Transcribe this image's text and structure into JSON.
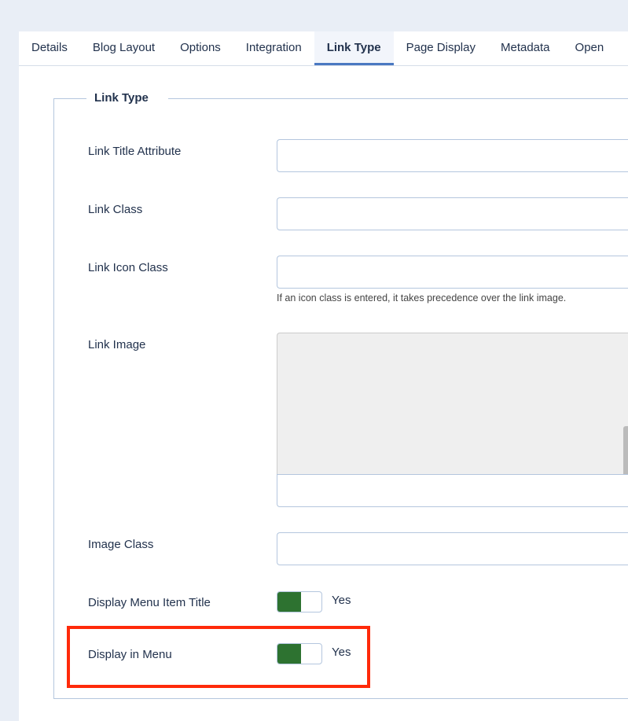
{
  "tabs": [
    "Details",
    "Blog Layout",
    "Options",
    "Integration",
    "Link Type",
    "Page Display",
    "Metadata",
    "Open"
  ],
  "active_tab": "Link Type",
  "fieldset": {
    "legend": "Link Type"
  },
  "fields": {
    "link_title": {
      "label": "Link Title Attribute",
      "value": ""
    },
    "link_class": {
      "label": "Link Class",
      "value": ""
    },
    "link_icon_class": {
      "label": "Link Icon Class",
      "value": "",
      "help": "If an icon class is entered, it takes precedence over the link image."
    },
    "link_image": {
      "label": "Link Image",
      "value": ""
    },
    "image_class": {
      "label": "Image Class",
      "value": ""
    },
    "display_title": {
      "label": "Display Menu Item Title",
      "state": "Yes",
      "on": true
    },
    "display_in_menu": {
      "label": "Display in Menu",
      "state": "Yes",
      "on": true
    }
  },
  "colors": {
    "toggle_on": "#2d7230",
    "highlight": "#ff2a0a",
    "active_tab": "#4a78c2"
  }
}
